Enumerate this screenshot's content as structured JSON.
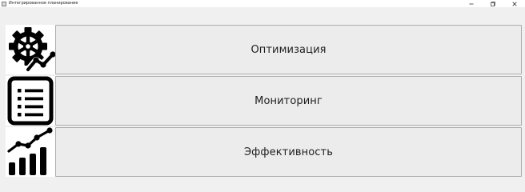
{
  "window": {
    "title": "Интегрированное планирование",
    "controls": {
      "minimize": "minimize-icon",
      "maximize": "maximize-icon",
      "close": "close-icon"
    }
  },
  "menu": {
    "items": [
      {
        "label": "Оптимизация",
        "icon": "gear-trend-icon"
      },
      {
        "label": "Мониторинг",
        "icon": "checklist-icon"
      },
      {
        "label": "Эффективность",
        "icon": "bar-chart-trend-icon"
      }
    ]
  },
  "colors": {
    "background": "#f0f0f0",
    "button_face": "#ececec",
    "button_border": "#adadad",
    "icon": "#000000"
  }
}
